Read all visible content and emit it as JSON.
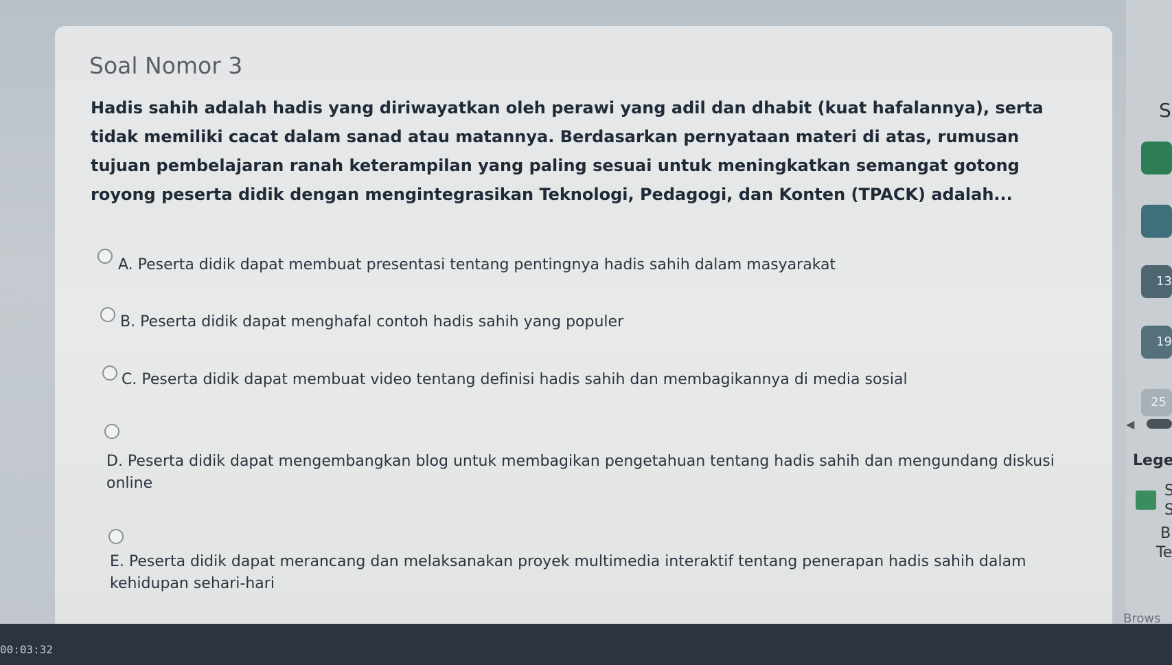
{
  "question": {
    "title": "Soal Nomor 3",
    "text": "Hadis sahih adalah hadis yang diriwayatkan oleh perawi yang adil dan dhabit (kuat hafalannya), serta tidak memiliki cacat dalam sanad atau matannya. Berdasarkan pernyataan materi di atas, rumusan tujuan pembelajaran ranah keterampilan yang paling sesuai untuk meningkatkan semangat gotong royong peserta didik dengan mengintegrasikan Teknologi, Pedagogi, dan Konten (TPACK) adalah..."
  },
  "options": [
    {
      "label": "A. Peserta didik dapat membuat presentasi tentang pentingnya hadis sahih dalam masyarakat"
    },
    {
      "label": "B. Peserta didik dapat menghafal contoh hadis sahih yang populer"
    },
    {
      "label": "C. Peserta didik dapat membuat video tentang definisi hadis sahih dan membagikannya di media sosial"
    },
    {
      "label": "D. Peserta didik dapat mengembangkan blog untuk membagikan pengetahuan tentang hadis sahih dan mengundang diskusi online"
    },
    {
      "label": "E. Peserta didik dapat merancang dan melaksanakan proyek multimedia interaktif tentang penerapan hadis sahih dalam kehidupan sehari-hari"
    }
  ],
  "sidebar": {
    "letter_s": "S",
    "num_1": "13",
    "num_2": "19",
    "num_3": "25",
    "legend": "Lege",
    "legend_s1": "S",
    "legend_s2": "S",
    "legend_b": "B",
    "legend_t": "Te",
    "browse": "Brows"
  },
  "timer": "00:03:32",
  "colors": {
    "accent_green": "#2f7d55",
    "accent_teal": "#3f6f7a"
  }
}
